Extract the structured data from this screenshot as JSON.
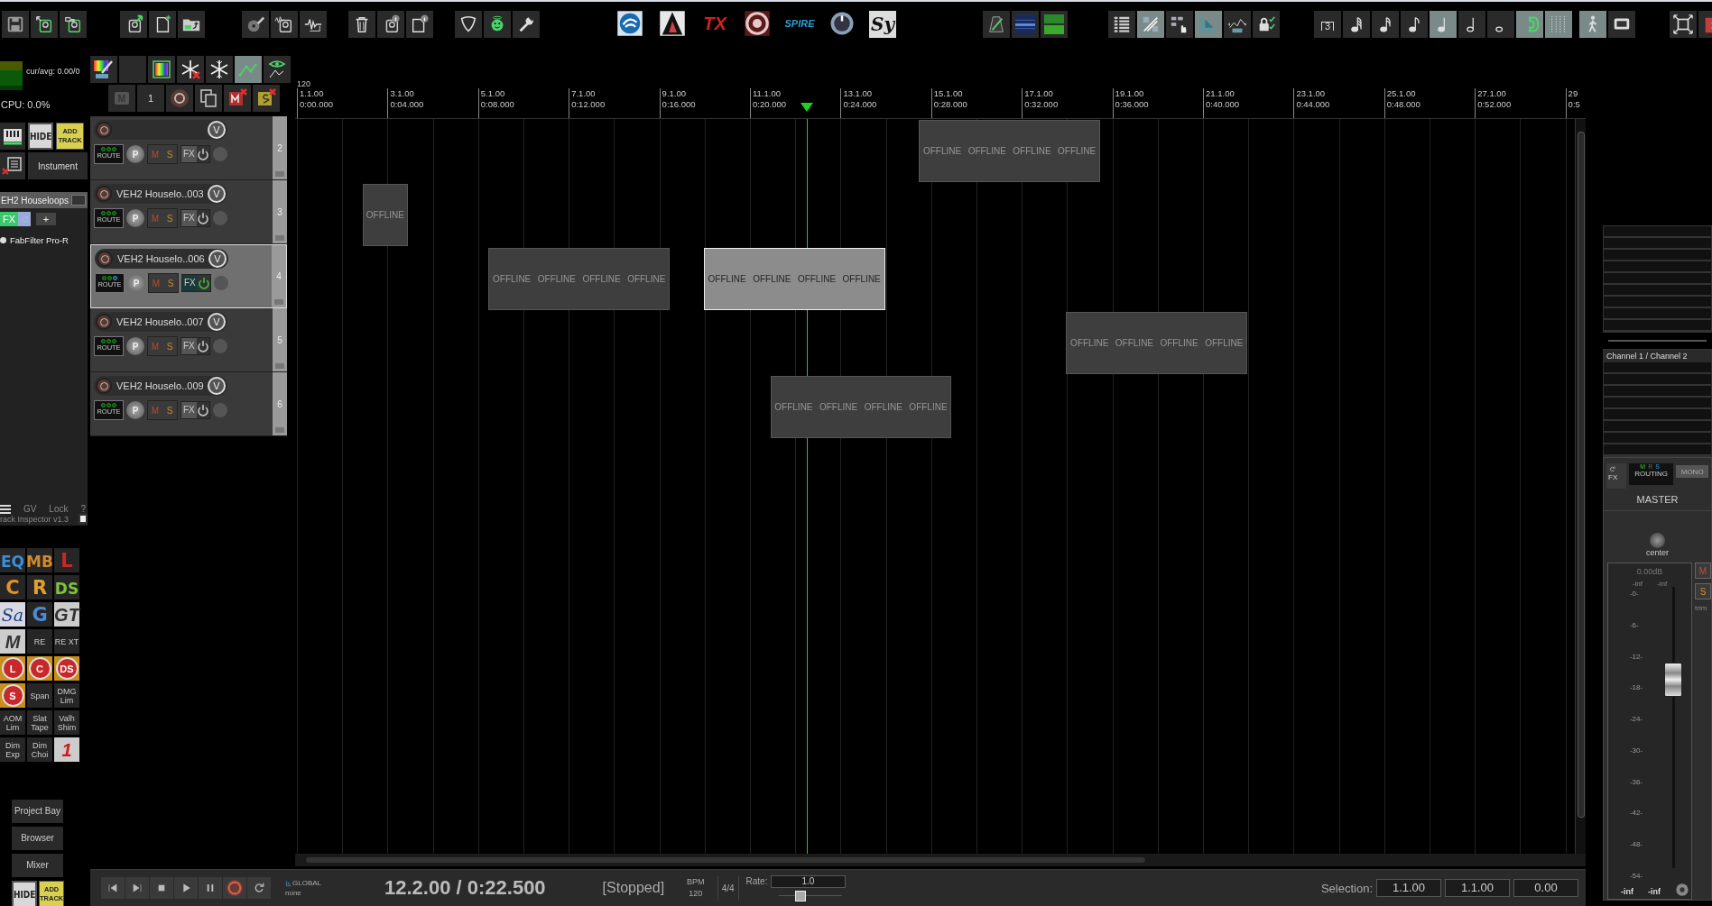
{
  "toolbar": {
    "groups": [
      [
        {
          "kind": "floppy",
          "on": false
        },
        {
          "kind": "disk-arrow",
          "on": false
        },
        {
          "kind": "disk-folder",
          "on": false
        }
      ],
      [
        {
          "kind": "disk-export",
          "on": false
        },
        {
          "kind": "file-star",
          "on": false
        },
        {
          "kind": "folder-arrow",
          "on": false
        }
      ],
      [
        {
          "kind": "disc-pencil",
          "on": false
        },
        {
          "kind": "wave-disk",
          "on": false
        },
        {
          "kind": "waveform",
          "on": false
        }
      ],
      [
        {
          "kind": "trash",
          "on": false
        },
        {
          "kind": "disk-info",
          "on": false
        },
        {
          "kind": "file-info",
          "on": false
        }
      ],
      [
        {
          "kind": "pick",
          "on": false
        },
        {
          "kind": "smiley",
          "on": false
        },
        {
          "kind": "wrench",
          "on": false
        }
      ],
      [
        {
          "kind": "metronome",
          "on": false
        },
        {
          "kind": "blue-meter",
          "on": false
        },
        {
          "kind": "green-meter",
          "on": false
        }
      ],
      [
        {
          "kind": "list",
          "on": false
        },
        {
          "kind": "link",
          "on": true
        },
        {
          "kind": "grid-hand",
          "on": false
        },
        {
          "kind": "snap",
          "on": true
        },
        {
          "kind": "envelope",
          "on": false
        },
        {
          "kind": "lock",
          "on": false
        }
      ],
      [
        {
          "kind": "triplet",
          "label": "3",
          "on": false
        },
        {
          "kind": "thirty-second-note",
          "on": false
        },
        {
          "kind": "sixteenth-note",
          "on": false
        },
        {
          "kind": "eighth-note",
          "on": false
        },
        {
          "kind": "quarter-note",
          "on": true
        },
        {
          "kind": "half-note",
          "on": false
        },
        {
          "kind": "whole-note",
          "on": false
        },
        {
          "kind": "magnet",
          "on": true
        },
        {
          "kind": "dots-grid",
          "on": true
        }
      ],
      [
        {
          "kind": "walker",
          "on": true
        },
        {
          "kind": "monitor",
          "on": false
        }
      ],
      [
        {
          "kind": "fullscreen",
          "on": false
        },
        {
          "kind": "folder-x",
          "on": false
        }
      ]
    ],
    "plugins": [
      {
        "kind": "swirl-logo"
      },
      {
        "kind": "triangle-logo"
      },
      {
        "kind": "label",
        "label": "TX",
        "color": "#d42020"
      },
      {
        "kind": "ring-logo"
      },
      {
        "kind": "label",
        "label": "SPIRE",
        "color": "#2aa0d8"
      },
      {
        "kind": "dial-logo"
      },
      {
        "kind": "label",
        "label": "Sy",
        "color": "#111111"
      }
    ]
  },
  "left": {
    "cpu_avg": "cur/avg: 0.00/0",
    "cpu": "CPU: 0.0%",
    "hide": "HIDE",
    "add_track": "ADD TRACK",
    "instrument": "Instument",
    "inspector": {
      "track": "EH2 Houseloops",
      "fx": "FX",
      "add": "+",
      "plugin": "FabFilter Pro-R",
      "tabs": [
        "GV",
        "Lock",
        "?"
      ],
      "title": "rack Inspector v1.3"
    },
    "plugins": [
      {
        "kind": "logo",
        "label": "EQ",
        "color": "#3a8fd8"
      },
      {
        "kind": "logo",
        "label": "MB",
        "color": "#d08a2a"
      },
      {
        "kind": "logo",
        "label": "L",
        "color": "#c8282a"
      },
      {
        "kind": "logo",
        "label": "C",
        "color": "#e0922a"
      },
      {
        "kind": "logo",
        "label": "R",
        "color": "#e0a030"
      },
      {
        "kind": "logo",
        "label": "DS",
        "color": "#7cc43a"
      },
      {
        "kind": "script",
        "label": "Sa",
        "color": "#1a3c8a"
      },
      {
        "kind": "logo",
        "label": "G",
        "color": "#4a8ad8"
      },
      {
        "kind": "light",
        "label": "GT",
        "color": "#333333"
      },
      {
        "kind": "light",
        "label": "M",
        "color": "#333333"
      },
      {
        "kind": "text",
        "label": "RE"
      },
      {
        "kind": "text",
        "label": "RE XT"
      },
      {
        "kind": "badge",
        "label": "L",
        "color": "#c8282a"
      },
      {
        "kind": "badge",
        "label": "C",
        "color": "#c8282a"
      },
      {
        "kind": "badge",
        "label": "DS",
        "color": "#c8282a"
      },
      {
        "kind": "badge",
        "label": "S",
        "color": "#c8282a"
      },
      {
        "kind": "text",
        "label": "Span"
      },
      {
        "kind": "text",
        "label": "DMG Lim"
      },
      {
        "kind": "text",
        "label": "AOM Lim"
      },
      {
        "kind": "text",
        "label": "Slat Tape"
      },
      {
        "kind": "text",
        "label": "Valh Shim"
      },
      {
        "kind": "text",
        "label": "Dim Exp"
      },
      {
        "kind": "text",
        "label": "Dim Choi"
      },
      {
        "kind": "light",
        "label": "1",
        "color": "#d01818"
      }
    ],
    "nav": [
      "Project Bay",
      "Browser",
      "Mixer"
    ],
    "hide_bottom": "HIDE",
    "add_track_bottom": "ADD TRACK"
  },
  "track_toolbar": [
    [
      {
        "kind": "brush"
      },
      {
        "kind": "blank"
      },
      {
        "kind": "color-bars"
      },
      {
        "kind": "snowflake-x"
      },
      {
        "kind": "snowflake"
      },
      {
        "kind": "envelope-points",
        "on": true
      },
      {
        "kind": "eye-points"
      }
    ],
    [
      {
        "kind": "label",
        "label": "M"
      },
      {
        "kind": "label",
        "label": "1"
      },
      {
        "kind": "record-disc"
      },
      {
        "kind": "copy"
      },
      {
        "kind": "mute-x"
      },
      {
        "kind": "solo-x"
      }
    ]
  ],
  "tracks": [
    {
      "number": "2",
      "selected": false,
      "fx_on": false,
      "controls": {
        "volume": "V",
        "route": "ROUTE",
        "pan": "P",
        "mute": "M",
        "solo": "S",
        "fx": "FX"
      },
      "items": [
        {
          "selected": false,
          "labels": [
            "OFFLINE",
            "OFFLINE",
            "OFFLINE",
            "OFFLINE"
          ]
        }
      ]
    },
    {
      "number": "3",
      "name": "VEH2 Houselo..003",
      "selected": false,
      "fx_on": false,
      "controls": {
        "volume": "V",
        "route": "ROUTE",
        "pan": "P",
        "mute": "M",
        "solo": "S",
        "fx": "FX"
      },
      "items": [
        {
          "selected": false,
          "labels": [
            "OFFLINE"
          ]
        }
      ]
    },
    {
      "number": "4",
      "name": "VEH2 Houselo..006",
      "selected": true,
      "fx_on": true,
      "controls": {
        "volume": "V",
        "route": "ROUTE",
        "pan": "P",
        "mute": "M",
        "solo": "S",
        "fx": "FX"
      },
      "items": [
        {
          "selected": false,
          "labels": [
            "OFFLINE",
            "OFFLINE",
            "OFFLINE",
            "OFFLINE"
          ]
        },
        {
          "selected": true,
          "labels": [
            "OFFLINE",
            "OFFLINE",
            "OFFLINE",
            "OFFLINE"
          ]
        }
      ]
    },
    {
      "number": "5",
      "name": "VEH2 Houselo..007",
      "selected": false,
      "fx_on": false,
      "controls": {
        "volume": "V",
        "route": "ROUTE",
        "pan": "P",
        "mute": "M",
        "solo": "S",
        "fx": "FX"
      },
      "items": [
        {
          "selected": false,
          "labels": [
            "OFFLINE",
            "OFFLINE",
            "OFFLINE",
            "OFFLINE"
          ]
        }
      ]
    },
    {
      "number": "6",
      "name": "VEH2 Houselo..009",
      "selected": false,
      "fx_on": false,
      "controls": {
        "volume": "V",
        "route": "ROUTE",
        "pan": "P",
        "mute": "M",
        "solo": "S",
        "fx": "FX"
      },
      "items": [
        {
          "selected": false,
          "labels": [
            "OFFLINE",
            "OFFLINE",
            "OFFLINE",
            "OFFLINE"
          ]
        }
      ]
    }
  ],
  "ruler": {
    "tempo": "120",
    "marks": [
      {
        "bar": "1.1.00",
        "time": "0:00.000"
      },
      {
        "bar": "3.1.00",
        "time": "0:04.000"
      },
      {
        "bar": "5.1.00",
        "time": "0:08.000"
      },
      {
        "bar": "7.1.00",
        "time": "0:12.000"
      },
      {
        "bar": "9.1.00",
        "time": "0:16.000"
      },
      {
        "bar": "11.1.00",
        "time": "0:20.000"
      },
      {
        "bar": "13.1.00",
        "time": "0:24.000"
      },
      {
        "bar": "15.1.00",
        "time": "0:28.000"
      },
      {
        "bar": "17.1.00",
        "time": "0:32.000"
      },
      {
        "bar": "19.1.00",
        "time": "0:36.000"
      },
      {
        "bar": "21.1.00",
        "time": "0:40.000"
      },
      {
        "bar": "23.1.00",
        "time": "0:44.000"
      },
      {
        "bar": "25.1.00",
        "time": "0:48.000"
      },
      {
        "bar": "27.1.00",
        "time": "0:52.000"
      },
      {
        "bar": "29",
        "time": "0:5"
      }
    ]
  },
  "master": {
    "io_label": "Channel 1 / Channel 2",
    "fx": "FX",
    "routing_letters": [
      "M",
      "R",
      "S"
    ],
    "routing": "ROUTING",
    "mono": "MONO",
    "name": "MASTER",
    "pan": "center",
    "volume": "0.00dB",
    "peaks": [
      "-inf",
      "-inf"
    ],
    "scale": [
      "-0-",
      "-6-",
      "-12-",
      "-18-",
      "-24-",
      "-30-",
      "-36-",
      "-42-",
      "-48-",
      "-54-"
    ],
    "peaks_bottom": [
      "-inf",
      "-inf"
    ],
    "fader": {
      "level": 0.67
    },
    "mute": "M",
    "solo": "S",
    "trim": "trim"
  },
  "transport": {
    "buttons": [
      {
        "kind": "prev"
      },
      {
        "kind": "next"
      },
      {
        "kind": "stop"
      },
      {
        "kind": "play"
      },
      {
        "kind": "pause"
      },
      {
        "kind": "record"
      },
      {
        "kind": "loop"
      }
    ],
    "global": "GLOBAL",
    "global_value": "none",
    "position": "12.2.00 / 0:22.500",
    "state": "[Stopped]",
    "bpm_label": "BPM",
    "bpm": "120",
    "signature": "4/4",
    "rate_label": "Rate:",
    "rate": "1.0",
    "rate_slider": {
      "level": 0.35
    },
    "selection_label": "Selection:",
    "selection": [
      "1.1.00",
      "1.1.00",
      "0.00"
    ]
  }
}
